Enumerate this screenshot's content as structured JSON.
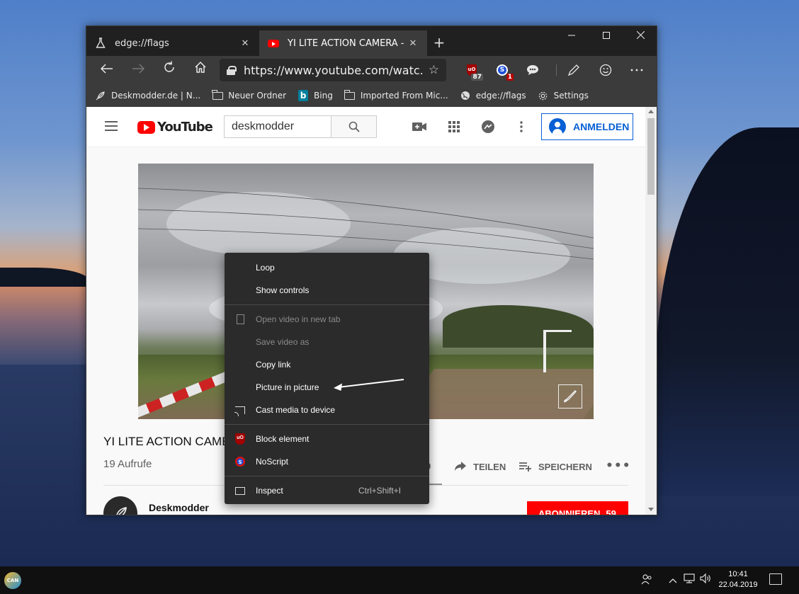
{
  "browser": {
    "tabs": [
      {
        "label": "edge://flags",
        "active": false
      },
      {
        "label": "YI LITE ACTION CAMERA - Zeitlu",
        "active": true
      }
    ],
    "address": {
      "url": "https://www.youtube.com/watc..."
    },
    "extensions": {
      "ublock_badge": "87",
      "noscript_badge": "1"
    },
    "bookmarks": [
      {
        "label": "Deskmodder.de | N...",
        "icon": "feather-icon"
      },
      {
        "label": "Neuer Ordner",
        "icon": "folder-icon"
      },
      {
        "label": "Bing",
        "icon": "bing-icon"
      },
      {
        "label": "Imported From Mic...",
        "icon": "folder-icon"
      },
      {
        "label": "edge://flags",
        "icon": "globe-icon"
      },
      {
        "label": "Settings",
        "icon": "gear-icon"
      }
    ]
  },
  "youtube": {
    "logo_text": "YouTube",
    "search_value": "deskmodder",
    "signin_label": "ANMELDEN",
    "video_title": "YI LITE ACTION CAME",
    "views": "19 Aufrufe",
    "likes": "0",
    "share_label": "TEILEN",
    "save_label": "SPEICHERN",
    "channel_name": "Deskmodder",
    "subscribe_label": "ABONNIEREN",
    "subscribe_count": "59"
  },
  "context_menu": {
    "loop": "Loop",
    "show_controls": "Show controls",
    "open_new_tab": "Open video in new tab",
    "save_video": "Save video as",
    "copy_link": "Copy link",
    "pip": "Picture in picture",
    "cast": "Cast media to device",
    "block_element": "Block element",
    "noscript": "NoScript",
    "inspect": "Inspect",
    "inspect_shortcut": "Ctrl+Shift+I"
  },
  "taskbar": {
    "time": "10:41",
    "date": "22.04.2019"
  },
  "colors": {
    "youtube_red": "#ff0000",
    "signin_blue": "#065fd4",
    "menu_bg": "#2b2b2b",
    "titlebar": "#202020",
    "toolbar": "#3b3b3b"
  }
}
